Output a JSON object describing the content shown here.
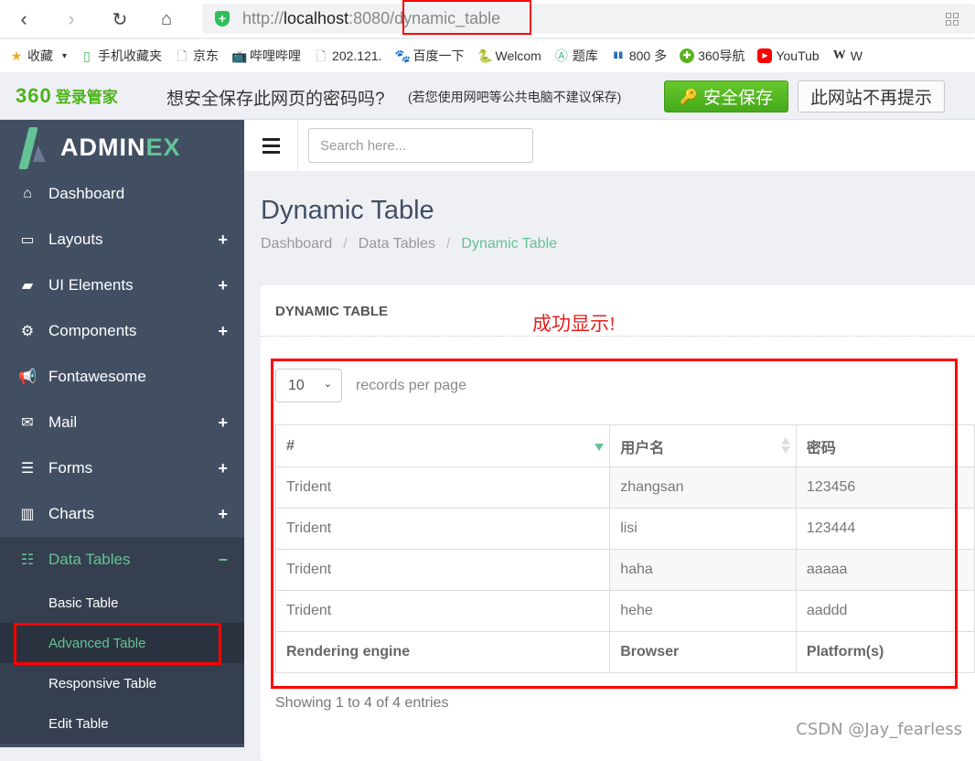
{
  "browser": {
    "url_prefix": "http://",
    "url_host": "localhost",
    "url_port": ":8080/",
    "url_path": "dynamic_table",
    "back_icon": "chevron-left-icon",
    "forward_icon": "chevron-right-icon",
    "reload_icon": "reload-icon",
    "home_icon": "home-icon",
    "secure_icon": "shield-plus-icon",
    "qr_icon": "qr-code-icon"
  },
  "bookmarks": [
    {
      "icon": "★",
      "label": "收藏",
      "dropdown": "▾"
    },
    {
      "icon": "▯",
      "label": "手机收藏夹"
    },
    {
      "icon": "🗋",
      "label": "京东"
    },
    {
      "icon": "📺",
      "label": "哔哩哔哩"
    },
    {
      "icon": "🗋",
      "label": "202.121."
    },
    {
      "icon": "🐾",
      "label": "百度一下"
    },
    {
      "icon": "🐍",
      "label": "Welcom"
    },
    {
      "icon": "Ⓐ",
      "label": "题库"
    },
    {
      "icon": "▮▮",
      "label": "800 多"
    },
    {
      "icon": "✚",
      "label": "360导航"
    },
    {
      "icon": "▶",
      "label": "YouTub"
    },
    {
      "icon": "W",
      "label": "W"
    }
  ],
  "password_bar": {
    "logo_number": "360",
    "logo_text": "登录管家",
    "question": "想安全保存此网页的密码吗?",
    "note": "(若您使用网吧等公共电脑不建议保存)",
    "save_label": "安全保存",
    "never_label": "此网站不再提示"
  },
  "sidebar": {
    "brand_main": "ADMIN",
    "brand_accent": "EX",
    "items": [
      {
        "label": "Dashboard",
        "icon": "⌂",
        "expand": ""
      },
      {
        "label": "Layouts",
        "icon": "▭",
        "expand": "+"
      },
      {
        "label": "UI Elements",
        "icon": "▰",
        "expand": "+"
      },
      {
        "label": "Components",
        "icon": "⚙",
        "expand": "+"
      },
      {
        "label": "Fontawesome",
        "icon": "📢",
        "expand": ""
      },
      {
        "label": "Mail",
        "icon": "✉",
        "expand": "+"
      },
      {
        "label": "Forms",
        "icon": "☰",
        "expand": "+"
      },
      {
        "label": "Charts",
        "icon": "▥",
        "expand": "+"
      },
      {
        "label": "Data Tables",
        "icon": "☷",
        "expand": "−"
      }
    ],
    "subitems": [
      {
        "label": "Basic Table"
      },
      {
        "label": "Advanced Table"
      },
      {
        "label": "Responsive Table"
      },
      {
        "label": "Edit Table"
      }
    ]
  },
  "header": {
    "search_placeholder": "Search here..."
  },
  "page": {
    "title": "Dynamic Table",
    "breadcrumb": [
      "Dashboard",
      "Data Tables",
      "Dynamic Table"
    ],
    "separator": "/"
  },
  "panel": {
    "title": "DYNAMIC TABLE",
    "annotation": "成功显示!",
    "page_length": "10",
    "page_length_label": "records per page",
    "columns": [
      "#",
      "用户名",
      "密码"
    ],
    "rows": [
      [
        "Trident",
        "zhangsan",
        "123456"
      ],
      [
        "Trident",
        "lisi",
        "123444"
      ],
      [
        "Trident",
        "haha",
        "aaaaa"
      ],
      [
        "Trident",
        "hehe",
        "aaddd"
      ]
    ],
    "footer_columns": [
      "Rendering engine",
      "Browser",
      "Platform(s)"
    ],
    "info": "Showing 1 to 4 of 4 entries"
  },
  "watermark": "CSDN @Jay_fearless",
  "colors": {
    "accent": "#65c295",
    "sidebar_bg": "#424f63",
    "annotation_red": "#ff0000",
    "save_green": "#4cb31a"
  }
}
